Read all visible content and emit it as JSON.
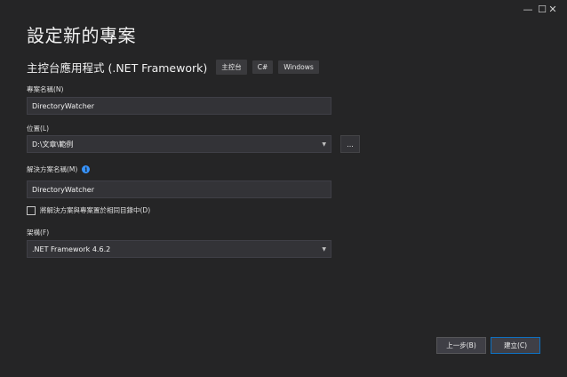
{
  "window": {
    "minimize_glyph": "—",
    "maximize_glyph": "☐",
    "close_glyph": "✕"
  },
  "header": {
    "title": "設定新的專案",
    "project_type": "主控台應用程式 (.NET Framework)",
    "tags": [
      "主控台",
      "C#",
      "Windows"
    ]
  },
  "form": {
    "project_name_label": "專案名稱(N)",
    "project_name_value": "DirectoryWatcher",
    "location_label": "位置(L)",
    "location_value": "D:\\文章\\範例",
    "browse_label": "...",
    "solution_name_label": "解決方案名稱(M)",
    "solution_info_glyph": "i",
    "solution_name_value": "DirectoryWatcher",
    "same_dir_checkbox_label": "將解決方案與專案置於相同目錄中(D)",
    "same_dir_checked": false,
    "framework_label": "架構(F)",
    "framework_value": ".NET Framework 4.6.2"
  },
  "footer": {
    "back_label": "上一步(B)",
    "create_label": "建立(C)"
  },
  "colors": {
    "background": "#252526",
    "field_background": "#333337",
    "accent": "#0e70c0",
    "info": "#3794ff"
  }
}
